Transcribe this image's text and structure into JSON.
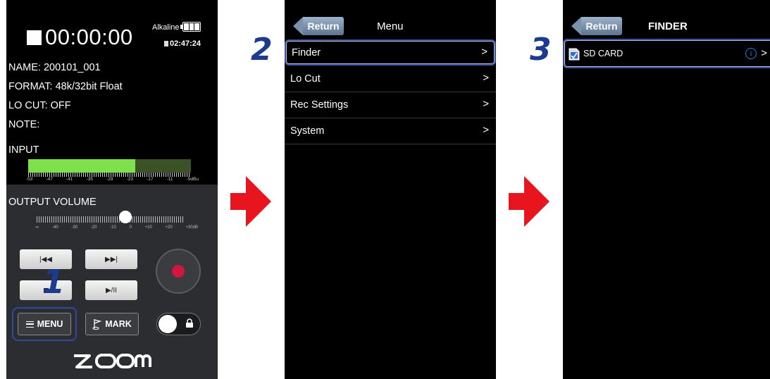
{
  "recorder": {
    "time": "00:00:00",
    "battery_label": "Alkaline",
    "remaining_time": "02:47:24",
    "info": {
      "name_key": "NAME:",
      "name_val": " 200101_001",
      "format_key": "FORMAT:",
      "format_val": " 48k/32bit Float",
      "locut_key": "LO CUT:",
      "locut_val": " OFF",
      "note_key": "NOTE:"
    },
    "input_label": "INPUT",
    "input_meter_level": 0.66,
    "meter_scale": [
      "-53",
      "-47",
      "-41",
      "-35",
      "-29",
      "-23",
      "-17",
      "-11",
      "-5dBu"
    ],
    "output_volume_label": "OUTPUT VOLUME",
    "output_volume_level": 0.6,
    "volume_scale": [
      "-∞",
      "-40",
      "-30",
      "-20",
      "-10",
      "0",
      "+10",
      "+20",
      "+30dB"
    ],
    "prev_label": "|◀◀",
    "next_label": "▶▶|",
    "play_pause_label": "▶/II",
    "menu_label": "MENU",
    "mark_label": "MARK",
    "logo": "ƨOOM",
    "accent_record": "#d3163f",
    "meter_color": "#7ee04a"
  },
  "steps": {
    "one": "1",
    "two": "2",
    "three": "3"
  },
  "menu_screen": {
    "return_label": "Return",
    "title": "Menu",
    "items": [
      {
        "label": "Finder",
        "chevron": ">"
      },
      {
        "label": "Lo Cut",
        "chevron": ">"
      },
      {
        "label": "Rec Settings",
        "chevron": ">"
      },
      {
        "label": "System",
        "chevron": ">"
      }
    ]
  },
  "finder_screen": {
    "return_label": "Return",
    "title": "FINDER",
    "items": [
      {
        "label": "SD CARD",
        "info_icon": "i",
        "chevron": ">"
      }
    ]
  },
  "colors": {
    "step_blue": "#1c3a8e",
    "arrow_red": "#e8141e",
    "highlight": "#3a4f9a"
  }
}
